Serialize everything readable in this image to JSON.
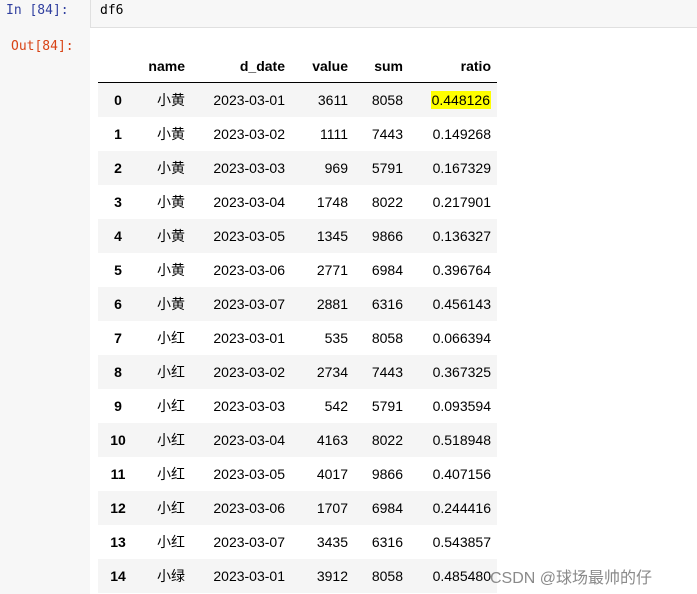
{
  "input_cell": {
    "prompt": "In  [84]:",
    "code": "df6"
  },
  "output_cell": {
    "prompt": "Out[84]:"
  },
  "table": {
    "columns": [
      "",
      "name",
      "d_date",
      "value",
      "sum",
      "ratio"
    ],
    "rows": [
      {
        "index": "0",
        "name": "小黄",
        "d_date": "2023-03-01",
        "value": "3611",
        "sum": "8058",
        "ratio": "0.448126"
      },
      {
        "index": "1",
        "name": "小黄",
        "d_date": "2023-03-02",
        "value": "1111",
        "sum": "7443",
        "ratio": "0.149268"
      },
      {
        "index": "2",
        "name": "小黄",
        "d_date": "2023-03-03",
        "value": "969",
        "sum": "5791",
        "ratio": "0.167329"
      },
      {
        "index": "3",
        "name": "小黄",
        "d_date": "2023-03-04",
        "value": "1748",
        "sum": "8022",
        "ratio": "0.217901"
      },
      {
        "index": "4",
        "name": "小黄",
        "d_date": "2023-03-05",
        "value": "1345",
        "sum": "9866",
        "ratio": "0.136327"
      },
      {
        "index": "5",
        "name": "小黄",
        "d_date": "2023-03-06",
        "value": "2771",
        "sum": "6984",
        "ratio": "0.396764"
      },
      {
        "index": "6",
        "name": "小黄",
        "d_date": "2023-03-07",
        "value": "2881",
        "sum": "6316",
        "ratio": "0.456143"
      },
      {
        "index": "7",
        "name": "小红",
        "d_date": "2023-03-01",
        "value": "535",
        "sum": "8058",
        "ratio": "0.066394"
      },
      {
        "index": "8",
        "name": "小红",
        "d_date": "2023-03-02",
        "value": "2734",
        "sum": "7443",
        "ratio": "0.367325"
      },
      {
        "index": "9",
        "name": "小红",
        "d_date": "2023-03-03",
        "value": "542",
        "sum": "5791",
        "ratio": "0.093594"
      },
      {
        "index": "10",
        "name": "小红",
        "d_date": "2023-03-04",
        "value": "4163",
        "sum": "8022",
        "ratio": "0.518948"
      },
      {
        "index": "11",
        "name": "小红",
        "d_date": "2023-03-05",
        "value": "4017",
        "sum": "9866",
        "ratio": "0.407156"
      },
      {
        "index": "12",
        "name": "小红",
        "d_date": "2023-03-06",
        "value": "1707",
        "sum": "6984",
        "ratio": "0.244416"
      },
      {
        "index": "13",
        "name": "小红",
        "d_date": "2023-03-07",
        "value": "3435",
        "sum": "6316",
        "ratio": "0.543857"
      },
      {
        "index": "14",
        "name": "小绿",
        "d_date": "2023-03-01",
        "value": "3912",
        "sum": "8058",
        "ratio": "0.485480"
      }
    ],
    "highlighted_cell": {
      "row": 0,
      "column": "ratio",
      "color": "#ffff00"
    }
  },
  "watermark": "CSDN @球场最帅的仔"
}
